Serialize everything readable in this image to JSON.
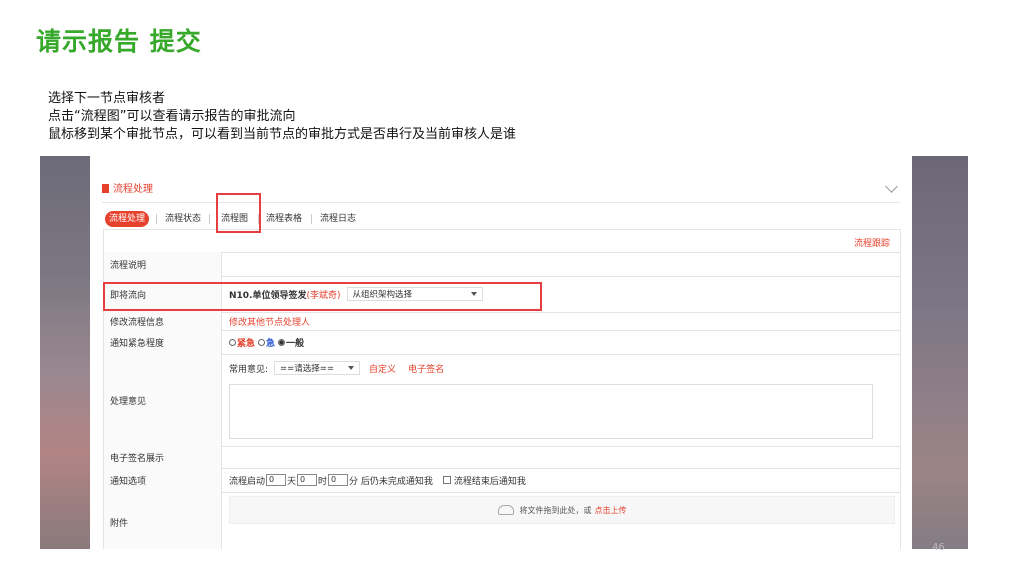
{
  "slide": {
    "title": "请示报告 提交",
    "desc": [
      "选择下一节点审核者",
      "点击“流程图”可以查看请示报告的审批流向",
      "鼠标移到某个审批节点，可以看到当前节点的审批方式是否串行及当前审核人是谁"
    ],
    "page_number": "46"
  },
  "panel": {
    "title": "流程处理",
    "tabs": [
      "流程处理",
      "流程状态",
      "流程图",
      "流程表格",
      "流程日志"
    ],
    "track_link": "流程跟踪"
  },
  "form": {
    "flow_desc_label": "流程说明",
    "next_label": "即将流向",
    "next_node": "N10.单位领导签发",
    "next_person": "(李斌奇)",
    "org_select": "从组织架构选择",
    "modify_label": "修改流程信息",
    "modify_link": "修改其他节点处理人",
    "urgency_label": "通知紧急程度",
    "urgency_options": [
      "紧急",
      "急",
      "一般"
    ],
    "opinion_label": "处理意见",
    "common_opinion_label": "常用意见:",
    "common_opinion_select": "==请选择==",
    "custom_link": "自定义",
    "esign_link": "电子签名",
    "esign_show_label": "电子签名展示",
    "notify_label": "通知选项",
    "notify_start": "流程启动",
    "notify_day_value": "0",
    "notify_day": "天",
    "notify_hour_value": "0",
    "notify_hour": "时",
    "notify_min_value": "0",
    "notify_min": "分 后仍未完成通知我",
    "notify_end": "流程结束后通知我",
    "attach_label": "附件",
    "upload_text": "将文件拖到此处，或",
    "upload_link": "点击上传"
  },
  "colors": {
    "title_green": "#36a82a",
    "accent_red": "#e5412d",
    "highlight_red": "#e63f3f"
  }
}
